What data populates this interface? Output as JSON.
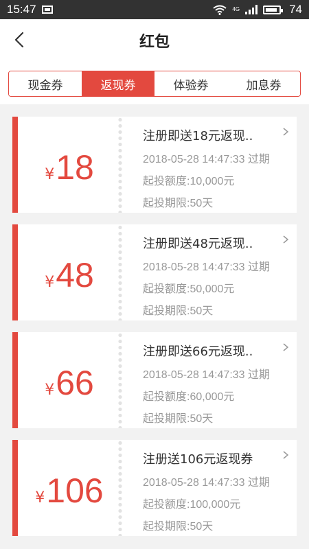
{
  "status_bar": {
    "time": "15:47",
    "network": "4G",
    "battery": "74"
  },
  "header": {
    "title": "红包"
  },
  "tabs": [
    {
      "label": "现金券",
      "active": false
    },
    {
      "label": "返现券",
      "active": true
    },
    {
      "label": "体验券",
      "active": false
    },
    {
      "label": "加息券",
      "active": false
    }
  ],
  "coupons": [
    {
      "currency": "¥",
      "amount": "18",
      "name": "注册即送18元返现..",
      "expiry": "2018-05-28 14:47:33 过期",
      "min_invest": "起投额度:10,000元",
      "min_term": "起投期限:50天"
    },
    {
      "currency": "¥",
      "amount": "48",
      "name": "注册即送48元返现..",
      "expiry": "2018-05-28 14:47:33 过期",
      "min_invest": "起投额度:50,000元",
      "min_term": "起投期限:50天"
    },
    {
      "currency": "¥",
      "amount": "66",
      "name": "注册即送66元返现..",
      "expiry": "2018-05-28 14:47:33 过期",
      "min_invest": "起投额度:60,000元",
      "min_term": "起投期限:50天"
    },
    {
      "currency": "¥",
      "amount": "106",
      "name": "注册送106元返现券",
      "expiry": "2018-05-28 14:47:33 过期",
      "min_invest": "起投额度:100,000元",
      "min_term": "起投期限:50天"
    }
  ],
  "colors": {
    "accent": "#e3493f",
    "status_bar": "#323232"
  }
}
